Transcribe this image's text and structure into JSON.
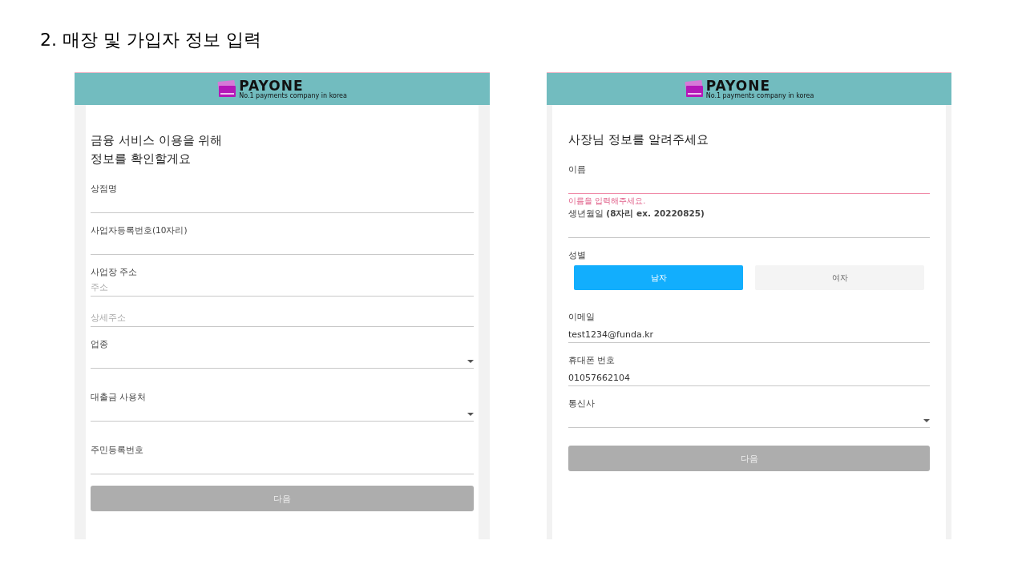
{
  "slide_title": "2. 매장 및 가입자 정보 입력",
  "screens": [
    {
      "logo": {
        "name": "PAYONE",
        "tagline": "No.1 payments company in korea"
      },
      "heading": [
        "금융 서비스 이용을 위해",
        "정보를 확인할게요"
      ],
      "fields": [
        {
          "kind": "input",
          "label": "상점명"
        },
        {
          "kind": "input",
          "label": "사업자등록번호(10자리)"
        },
        {
          "kind": "input",
          "label": "사업장 주소",
          "placeholder": "주소"
        },
        {
          "kind": "input",
          "placeholder": "상세주소"
        },
        {
          "kind": "select",
          "label": "업종"
        },
        {
          "kind": "select",
          "label": "대출금 사용처"
        },
        {
          "kind": "input",
          "label": "주민등록번호"
        }
      ],
      "button": {
        "label": "다음",
        "disabled": true
      }
    },
    {
      "logo": {
        "name": "PAYONE",
        "tagline": "No.1 payments company in korea"
      },
      "heading": [
        "사장님 정보를 알려주세요"
      ],
      "fields": [
        {
          "kind": "input",
          "label": "이름",
          "error": "이름을 입력해주세요."
        },
        {
          "kind": "input",
          "label": "생년월일 **(8자리 ex. 20220825)**"
        },
        {
          "kind": "choice",
          "label": "성별",
          "options": [
            {
              "label": "남자",
              "selected": true
            },
            {
              "label": "여자",
              "selected": false
            }
          ]
        },
        {
          "kind": "input",
          "label": "이메일",
          "value": "test1234@funda.kr"
        },
        {
          "kind": "input",
          "label": "휴대폰 번호",
          "value": "01057662104"
        },
        {
          "kind": "select",
          "label": "통신사"
        }
      ],
      "button": {
        "label": "다음",
        "disabled": true
      }
    }
  ]
}
